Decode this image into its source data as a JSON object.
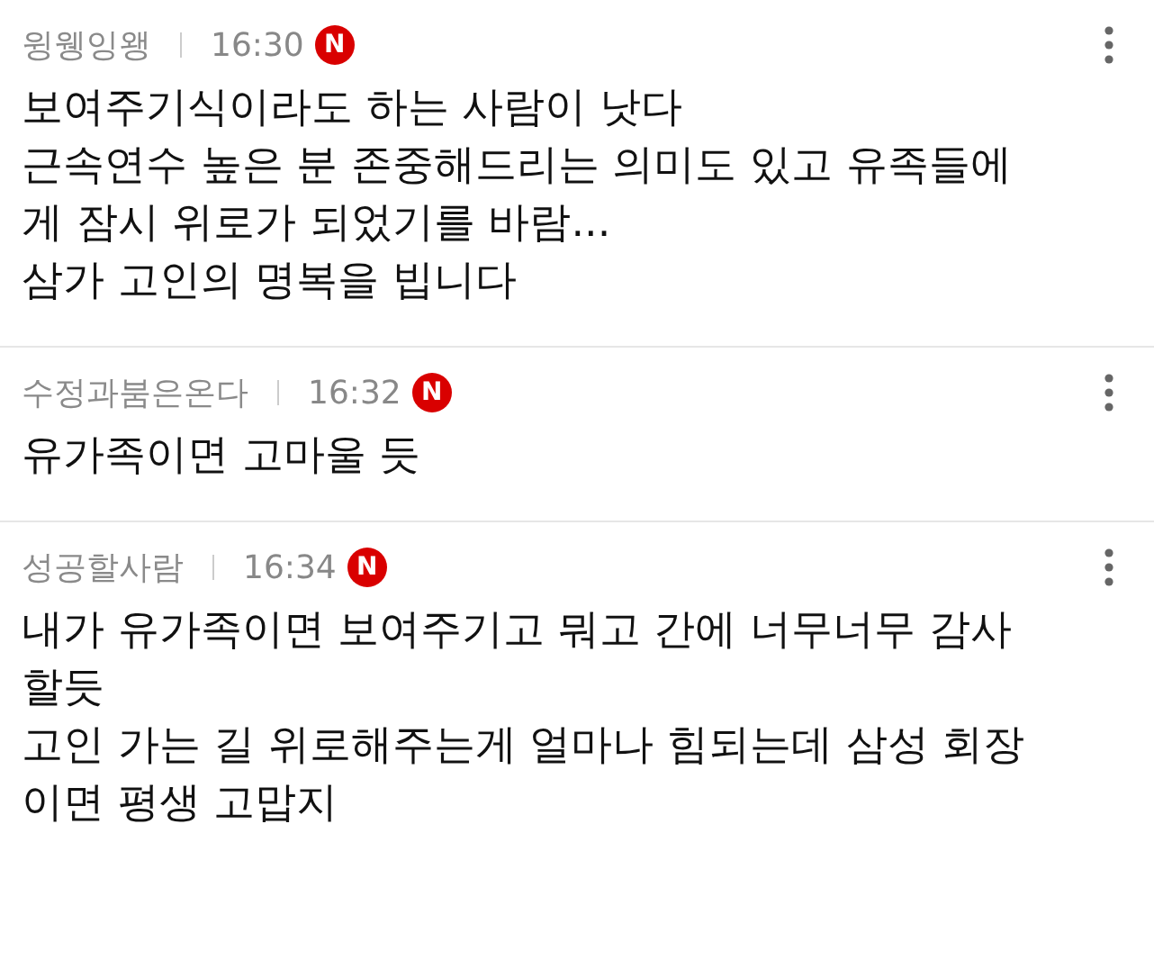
{
  "comments": [
    {
      "author": "윙웽잉왱",
      "time": "16:30",
      "badge": "N",
      "text": "보여주기식이라도 하는 사람이 낫다\n근속연수 높은 분 존중해드리는 의미도 있고 유족들에\n게 잠시 위로가 되었기를 바람...\n삼가 고인의 명복을 빕니다"
    },
    {
      "author": "수정과붐은온다",
      "time": "16:32",
      "badge": "N",
      "text": "유가족이면 고마울 듯"
    },
    {
      "author": "성공할사람",
      "time": "16:34",
      "badge": "N",
      "text": "내가 유가족이면 보여주기고 뭐고 간에 너무너무 감사\n할듯\n고인 가는 길 위로해주는게 얼마나 힘되는데 삼성 회장\n이면 평생 고맙지"
    }
  ]
}
